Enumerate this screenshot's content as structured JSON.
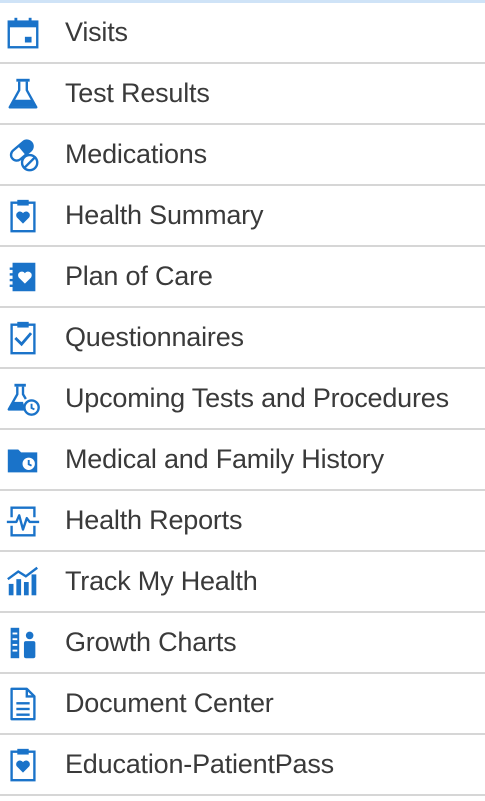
{
  "theme": {
    "icon_color": "#1a73c9",
    "text_color": "#3a3a3a",
    "divider_color": "#d6d6d6",
    "top_border_color": "#cfe3f7"
  },
  "menu": {
    "items": [
      {
        "label": "Visits",
        "icon": "calendar-icon"
      },
      {
        "label": "Test Results",
        "icon": "flask-icon"
      },
      {
        "label": "Medications",
        "icon": "pills-icon"
      },
      {
        "label": "Health Summary",
        "icon": "clipboard-heart-icon"
      },
      {
        "label": "Plan of Care",
        "icon": "notebook-heart-icon"
      },
      {
        "label": "Questionnaires",
        "icon": "clipboard-check-icon"
      },
      {
        "label": "Upcoming Tests and Procedures",
        "icon": "flask-clock-icon"
      },
      {
        "label": "Medical and Family History",
        "icon": "folder-clock-icon"
      },
      {
        "label": "Health Reports",
        "icon": "heartbeat-icon"
      },
      {
        "label": "Track My Health",
        "icon": "bar-chart-icon"
      },
      {
        "label": "Growth Charts",
        "icon": "growth-chart-icon"
      },
      {
        "label": "Document Center",
        "icon": "document-icon"
      },
      {
        "label": "Education-PatientPass",
        "icon": "clipboard-heart-icon"
      }
    ]
  }
}
